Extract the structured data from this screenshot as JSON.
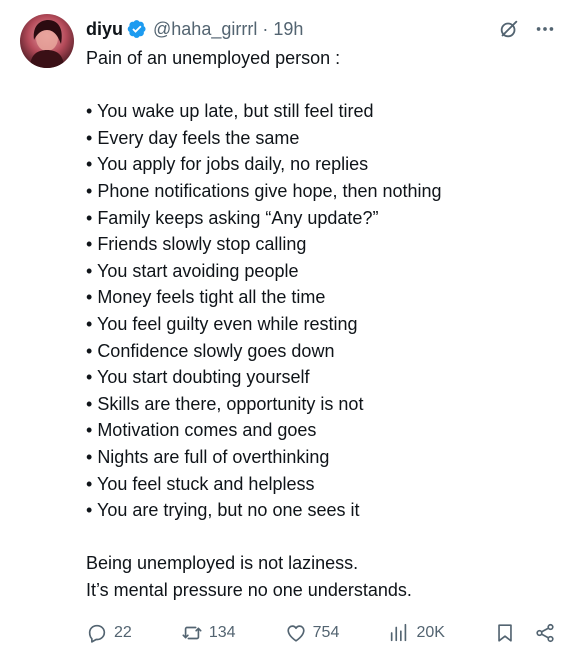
{
  "header": {
    "name": "diyu",
    "handle": "@haha_girrrl",
    "separator": "·",
    "time": "19h",
    "more_icon": "more-horizontal-icon",
    "grok_icon": "grok-icon",
    "verified_icon": "verified-badge-icon",
    "verified_color": "#1d9bf0"
  },
  "tweet": {
    "intro": "Pain of an unemployed person :",
    "bullets": [
      "You wake up late, but still feel tired",
      "Every day feels the same",
      "You apply for jobs daily, no replies",
      "Phone notifications give hope, then nothing",
      "Family keeps asking “Any update?”",
      "Friends slowly stop calling",
      "You start avoiding people",
      "Money feels tight all the time",
      "You feel guilty even while resting",
      "Confidence slowly goes down",
      "You start doubting yourself",
      "Skills are there, opportunity is not",
      "Motivation comes and goes",
      "Nights are full of overthinking",
      "You feel stuck and helpless",
      "You are trying, but no one sees it"
    ],
    "closing_1": "Being unemployed is not laziness.",
    "closing_2": "It’s mental pressure no one understands."
  },
  "actions": {
    "replies": "22",
    "reposts": "134",
    "likes": "754",
    "views": "20K",
    "icons": [
      "reply-icon",
      "repost-icon",
      "like-icon",
      "views-icon",
      "bookmark-icon",
      "share-icon"
    ],
    "icon_color": "#536471"
  }
}
